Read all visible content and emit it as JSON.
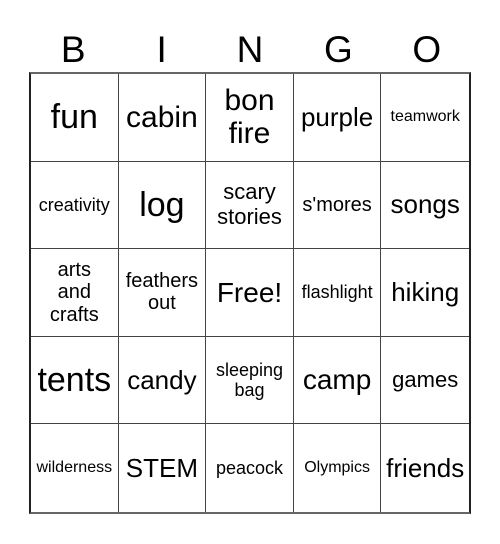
{
  "header": [
    "B",
    "I",
    "N",
    "G",
    "O"
  ],
  "cells": [
    [
      "fun",
      "cabin",
      "bon fire",
      "purple",
      "teamwork"
    ],
    [
      "creativity",
      "log",
      "scary stories",
      "s'mores",
      "songs"
    ],
    [
      "arts and crafts",
      "feathers out",
      "Free!",
      "flashlight",
      "hiking"
    ],
    [
      "tents",
      "candy",
      "sleeping bag",
      "camp",
      "games"
    ],
    [
      "wilderness",
      "STEM",
      "peacock",
      "Olympics",
      "friends"
    ]
  ]
}
